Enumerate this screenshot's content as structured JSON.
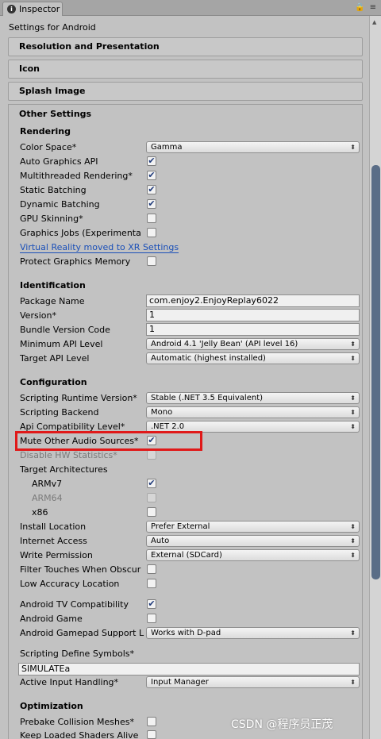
{
  "tab": {
    "title": "Inspector",
    "lock_icon": "lock-icon",
    "menu_icon": "menu-icon"
  },
  "panel_title": "Settings for Android",
  "sections": {
    "resolution": "Resolution and Presentation",
    "icon": "Icon",
    "splash": "Splash Image",
    "other": "Other Settings"
  },
  "rendering": {
    "heading": "Rendering",
    "color_space_label": "Color Space*",
    "color_space_value": "Gamma",
    "auto_graphics_api": "Auto Graphics API",
    "multithreaded": "Multithreaded Rendering*",
    "static_batching": "Static Batching",
    "dynamic_batching": "Dynamic Batching",
    "gpu_skinning": "GPU Skinning*",
    "graphics_jobs": "Graphics Jobs (Experimenta",
    "vr_link": "Virtual Reality moved to XR Settings",
    "protect_memory": "Protect Graphics Memory"
  },
  "identification": {
    "heading": "Identification",
    "package_name_label": "Package Name",
    "package_name_value": "com.enjoy2.EnjoyReplay6022",
    "version_label": "Version*",
    "version_value": "1",
    "bundle_code_label": "Bundle Version Code",
    "bundle_code_value": "1",
    "min_api_label": "Minimum API Level",
    "min_api_value": "Android 4.1 'Jelly Bean' (API level 16)",
    "target_api_label": "Target API Level",
    "target_api_value": "Automatic (highest installed)"
  },
  "configuration": {
    "heading": "Configuration",
    "runtime_label": "Scripting Runtime Version*",
    "runtime_value": "Stable (.NET 3.5 Equivalent)",
    "backend_label": "Scripting Backend",
    "backend_value": "Mono",
    "api_compat_label": "Api Compatibility Level*",
    "api_compat_value": ".NET 2.0",
    "mute_audio": "Mute Other Audio Sources*",
    "disable_hw": "Disable HW Statistics*",
    "target_arch": "Target Architectures",
    "armv7": "ARMv7",
    "arm64": "ARM64",
    "x86": "x86",
    "install_location_label": "Install Location",
    "install_location_value": "Prefer External",
    "internet_label": "Internet Access",
    "internet_value": "Auto",
    "write_perm_label": "Write Permission",
    "write_perm_value": "External (SDCard)",
    "filter_touches": "Filter Touches When Obscur",
    "low_accuracy": "Low Accuracy Location",
    "android_tv": "Android TV Compatibility",
    "android_game": "Android Game",
    "gamepad_label": "Android Gamepad Support L",
    "gamepad_value": "Works with D-pad",
    "define_symbols_label": "Scripting Define Symbols*",
    "define_symbols_value": "SIMULATEa",
    "input_handling_label": "Active Input Handling*",
    "input_handling_value": "Input Manager"
  },
  "optimization": {
    "heading": "Optimization",
    "prebake": "Prebake Collision Meshes*",
    "keep_shaders": "Keep Loaded Shaders Alive"
  },
  "checkbox_states": {
    "auto_graphics_api": true,
    "multithreaded": true,
    "static_batching": true,
    "dynamic_batching": true,
    "gpu_skinning": false,
    "graphics_jobs": false,
    "protect_memory": false,
    "mute_audio": true,
    "disable_hw": false,
    "armv7": true,
    "arm64": false,
    "x86": false,
    "filter_touches": false,
    "low_accuracy": false,
    "android_tv": true,
    "android_game": false,
    "prebake": false,
    "keep_shaders": false
  },
  "colors": {
    "highlight": "#e01919",
    "link": "#1a4fb8",
    "scroll_thumb": "#5a6d87"
  },
  "watermark": "CSDN @程序员正茂"
}
